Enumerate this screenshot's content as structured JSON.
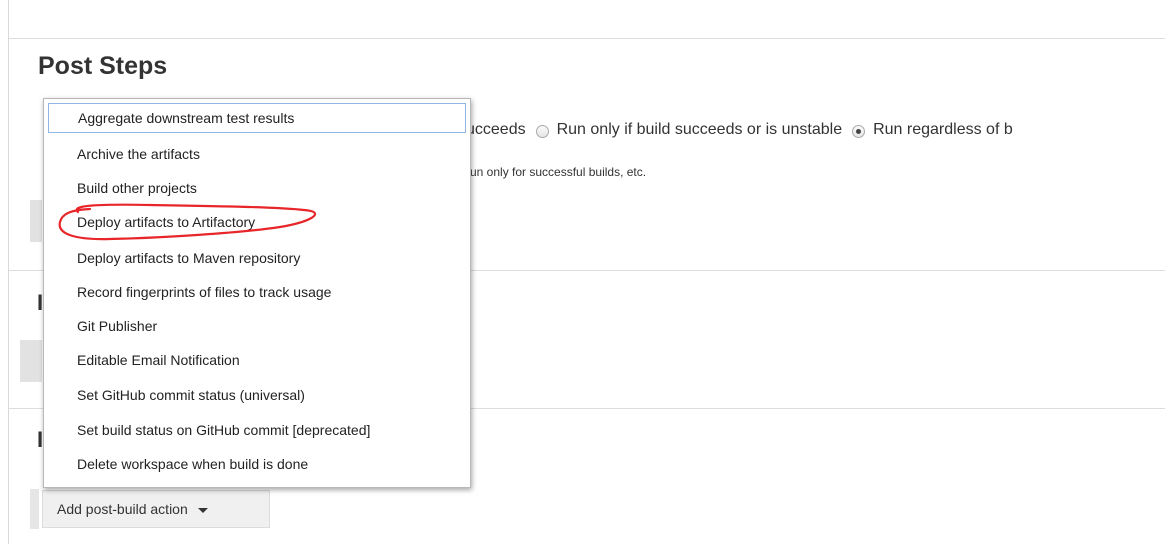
{
  "section": {
    "title": "Post Steps"
  },
  "post_steps": {
    "radio_options": [
      {
        "label": "ucceeds",
        "checked": false
      },
      {
        "label": "Run only if build succeeds or is unstable",
        "checked": false
      },
      {
        "label": "Run regardless of b",
        "checked": true
      }
    ],
    "help_text": "run only for successful builds, etc."
  },
  "dropdown": {
    "items": [
      "Aggregate downstream test results",
      "Archive the artifacts",
      "Build other projects",
      "Deploy artifacts to Artifactory",
      "Deploy artifacts to Maven repository",
      "Record fingerprints of files to track usage",
      "Git Publisher",
      "Editable Email Notification",
      "Set GitHub commit status (universal)",
      "Set build status on GitHub commit [deprecated]",
      "Delete workspace when build is done"
    ],
    "focused_index": 0,
    "highlighted_index": 3
  },
  "hidden_sections": {
    "letter": "I"
  },
  "post_build": {
    "add_button_label": "Add post-build action",
    "caret_icon": "caret-down-icon"
  },
  "colors": {
    "annotation": "#e8262a",
    "focus_border": "#90b6e6"
  }
}
